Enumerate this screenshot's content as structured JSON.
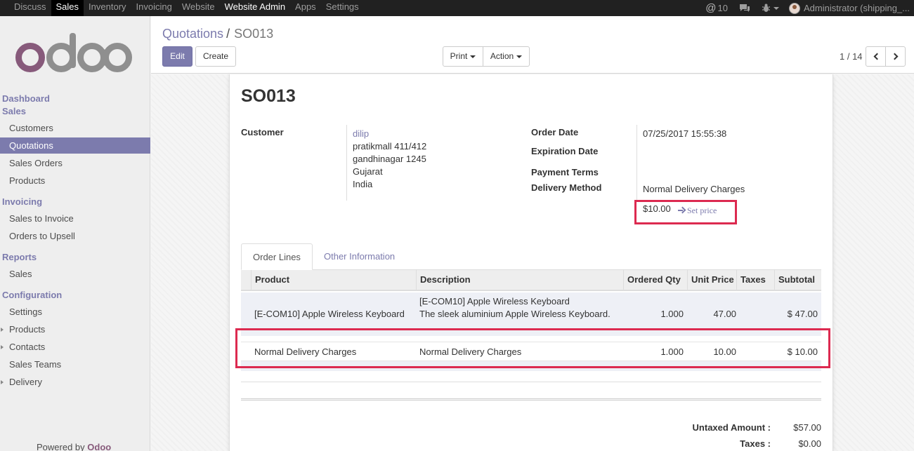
{
  "topbar": {
    "menu": [
      "Discuss",
      "Sales",
      "Inventory",
      "Invoicing",
      "Website",
      "Website Admin",
      "Apps",
      "Settings"
    ],
    "mentions": "10",
    "user": "Administrator (shipping_..."
  },
  "sidebar": {
    "sections": {
      "dashboard": "Dashboard",
      "sales": "Sales",
      "invoicing": "Invoicing",
      "reports": "Reports",
      "configuration": "Configuration"
    },
    "sales_items": [
      "Customers",
      "Quotations",
      "Sales Orders",
      "Products"
    ],
    "invoicing_items": [
      "Sales to Invoice",
      "Orders to Upsell"
    ],
    "reports_items": [
      "Sales"
    ],
    "config_items": [
      "Settings",
      "Products",
      "Contacts",
      "Sales Teams",
      "Delivery"
    ],
    "powered_prefix": "Powered by ",
    "powered_brand": "Odoo"
  },
  "control_panel": {
    "breadcrumb_parent": "Quotations",
    "breadcrumb_current": "SO013",
    "edit_label": "Edit",
    "create_label": "Create",
    "print_label": "Print",
    "action_label": "Action",
    "pager": "1 / 14"
  },
  "record": {
    "name": "SO013",
    "customer_label": "Customer",
    "customer_name": "dilip",
    "address": [
      "pratikmall 411/412",
      "gandhinagar 1245",
      "Gujarat",
      "India"
    ],
    "order_date_label": "Order Date",
    "order_date": "07/25/2017 15:55:38",
    "expiration_label": "Expiration Date",
    "payment_terms_label": "Payment Terms",
    "delivery_method_label": "Delivery Method",
    "delivery_method": "Normal Delivery Charges",
    "delivery_price": "$10.00",
    "set_price": "Set price"
  },
  "tabs": [
    "Order Lines",
    "Other Information"
  ],
  "order_lines": {
    "headers": [
      "Product",
      "Description",
      "Ordered Qty",
      "Unit Price",
      "Taxes",
      "Subtotal"
    ],
    "rows": [
      {
        "product": "[E-COM10] Apple Wireless Keyboard",
        "description_1": "[E-COM10] Apple Wireless Keyboard",
        "description_2": "The sleek aluminium Apple Wireless Keyboard.",
        "qty": "1.000",
        "price": "47.00",
        "subtotal": "$ 47.00"
      },
      {
        "product": "Normal Delivery Charges",
        "description_1": "Normal Delivery Charges",
        "qty": "1.000",
        "price": "10.00",
        "subtotal": "$ 10.00"
      }
    ]
  },
  "totals": {
    "untaxed_label": "Untaxed Amount :",
    "untaxed_value": "$57.00",
    "taxes_label": "Taxes :",
    "taxes_value": "$0.00"
  },
  "colors": {
    "accent": "#7c7bad",
    "highlight_box": "#dc2a50",
    "brand": "#875a7b"
  }
}
